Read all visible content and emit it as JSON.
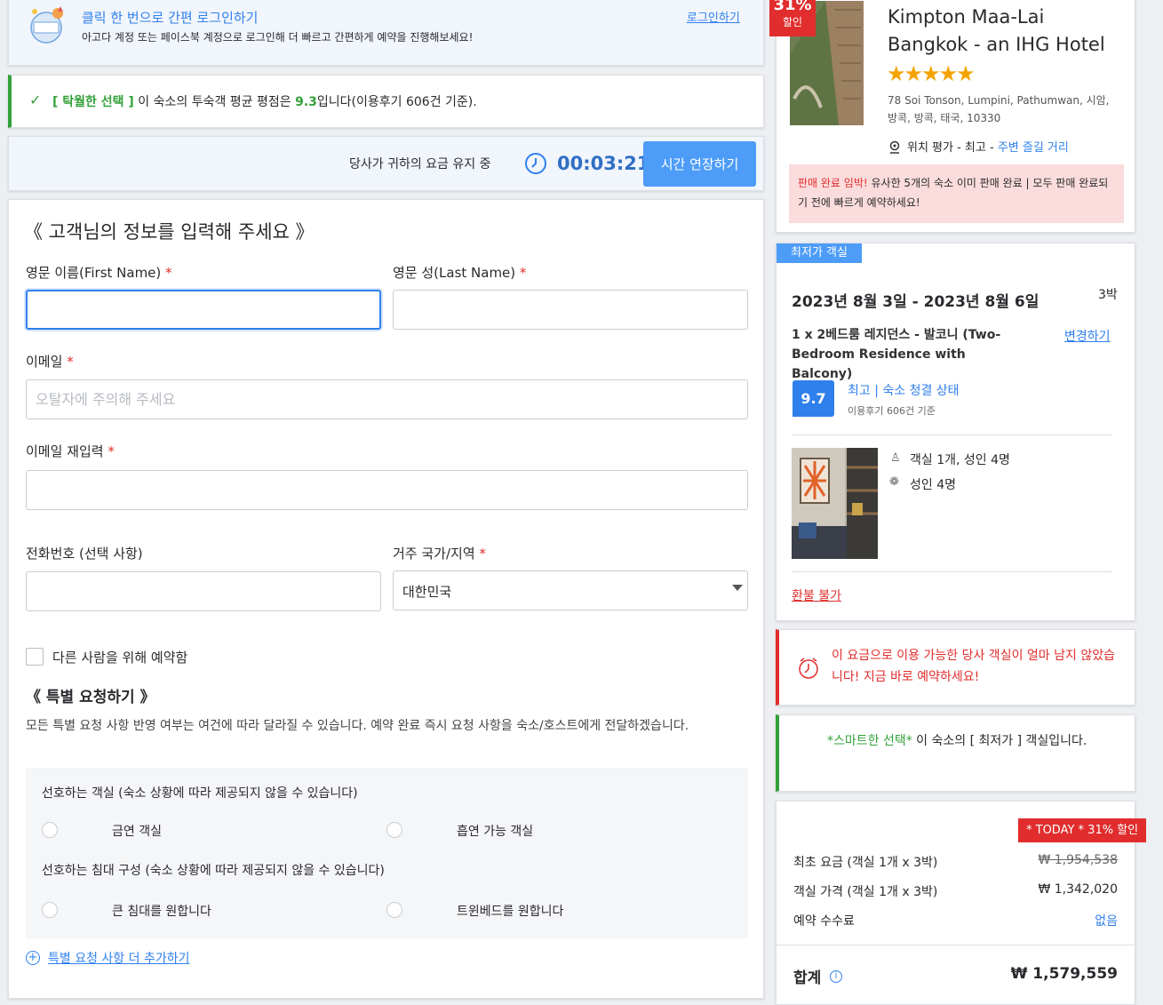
{
  "login_banner": {
    "title": "클릭 한 번으로 간편 로그인하기",
    "desc": "아고다 계정 또는 페이스북 계정으로 로그인해 더 빠르고 간편하게 예약을 진행해보세요!",
    "link": "로그인하기"
  },
  "rating_banner": {
    "tag": "[ 탁월한 선택 ]",
    "text_before": " 이 숙소의 투숙객 평균 평점은 ",
    "score": "9.3",
    "text_after": "입니다(이용후기 606건 기준)."
  },
  "timer_bar": {
    "text": "당사가 귀하의 요금 유지 중",
    "time": "00:03:21",
    "button": "시간 연장하기"
  },
  "form": {
    "title": "《 고객님의 정보를 입력해 주세요 》",
    "first_name_label": "영문 이름(First Name)",
    "last_name_label": "영문 성(Last Name)",
    "email_label": "이메일",
    "email_placeholder": "오탈자에 주의해 주세요",
    "email_confirm_label": "이메일 재입력",
    "phone_label": "전화번호 (선택 사항)",
    "country_label": "거주 국가/지역",
    "country_value": "대한민국",
    "required_mark": "*",
    "other_person_label": "다른 사람을 위해 예약함"
  },
  "special": {
    "title": "《 특별 요청하기 》",
    "desc": "모든 특별 요청 사항 반영 여부는 여건에 따라 달라질 수 있습니다. 예약 완료 즉시 요청 사항을 숙소/호스트에게 전달하겠습니다.",
    "room_pref_label": "선호하는 객실 (숙소 상황에 따라 제공되지 않을 수 있습니다)",
    "non_smoking": "금연 객실",
    "smoking": "흡연 가능 객실",
    "bed_pref_label": "선호하는 침대 구성 (숙소 상황에 따라 제공되지 않을 수 있습니다)",
    "large_bed": "큰 침대를 원합니다",
    "twin_bed": "트윈베드를 원합니다",
    "add_more": "특별 요청 사항 더 추가하기"
  },
  "hotel": {
    "discount_pct": "31%",
    "discount_word": "할인",
    "name_line1": "Kimpton Maa-Lai",
    "name_line2": "Bangkok - an IHG Hotel",
    "stars": "★★★★★",
    "address": "78 Soi Tonson, Lumpini, Pathumwan, 시암, 방콕, 방콕, 태국, 10330",
    "location_prefix": "위치 평가 - 최고 - ",
    "location_link": "주변 즐길 거리",
    "sellout_strong": "판매 완료 임박!",
    "sellout_text": "  유사한 5개의 숙소 이미 판매 완료 | 모두 판매 완료되기 전에 빠르게 예약하세요!"
  },
  "room": {
    "badge": "최저가 객실",
    "dates": "2023년 8월 3일 - 2023년 8월 6일",
    "nights": "3박",
    "room_name": "1 x 2베드룸 레지던스 - 발코니 (Two-Bedroom Residence with Balcony)",
    "change_link": "변경하기",
    "score": "9.7",
    "score_text": "최고 | 숙소 청결 상태",
    "score_sub": "이용후기 606건 기준",
    "occupancy": "객실 1개, 성인 4명",
    "adults": "성인 4명",
    "refund": "환불 불가"
  },
  "urgency": {
    "text": "이 요금으로 이용 가능한 당사 객실이 얼마 남지 않았습니다! 지금 바로 예약하세요!"
  },
  "smart": {
    "tag": "*스마트한 선택*",
    "text": " 이 숙소의 [ 최저가 ] 객실입니다."
  },
  "price": {
    "today_badge": "* TODAY * 31% 할인",
    "original_label": "최초 요금 (객실 1개 x 3박)",
    "original_value": "₩ 1,954,538",
    "room_label": "객실 가격 (객실 1개 x 3박)",
    "room_value": "₩ 1,342,020",
    "fee_label": "예약 수수료",
    "fee_value": "없음",
    "total_label": "합계",
    "total_value": "₩ 1,579,559"
  },
  "colors": {
    "accent": "#2f80ed",
    "green": "#33a13a",
    "red": "#e12d2d",
    "button": "#4d9cf8"
  }
}
